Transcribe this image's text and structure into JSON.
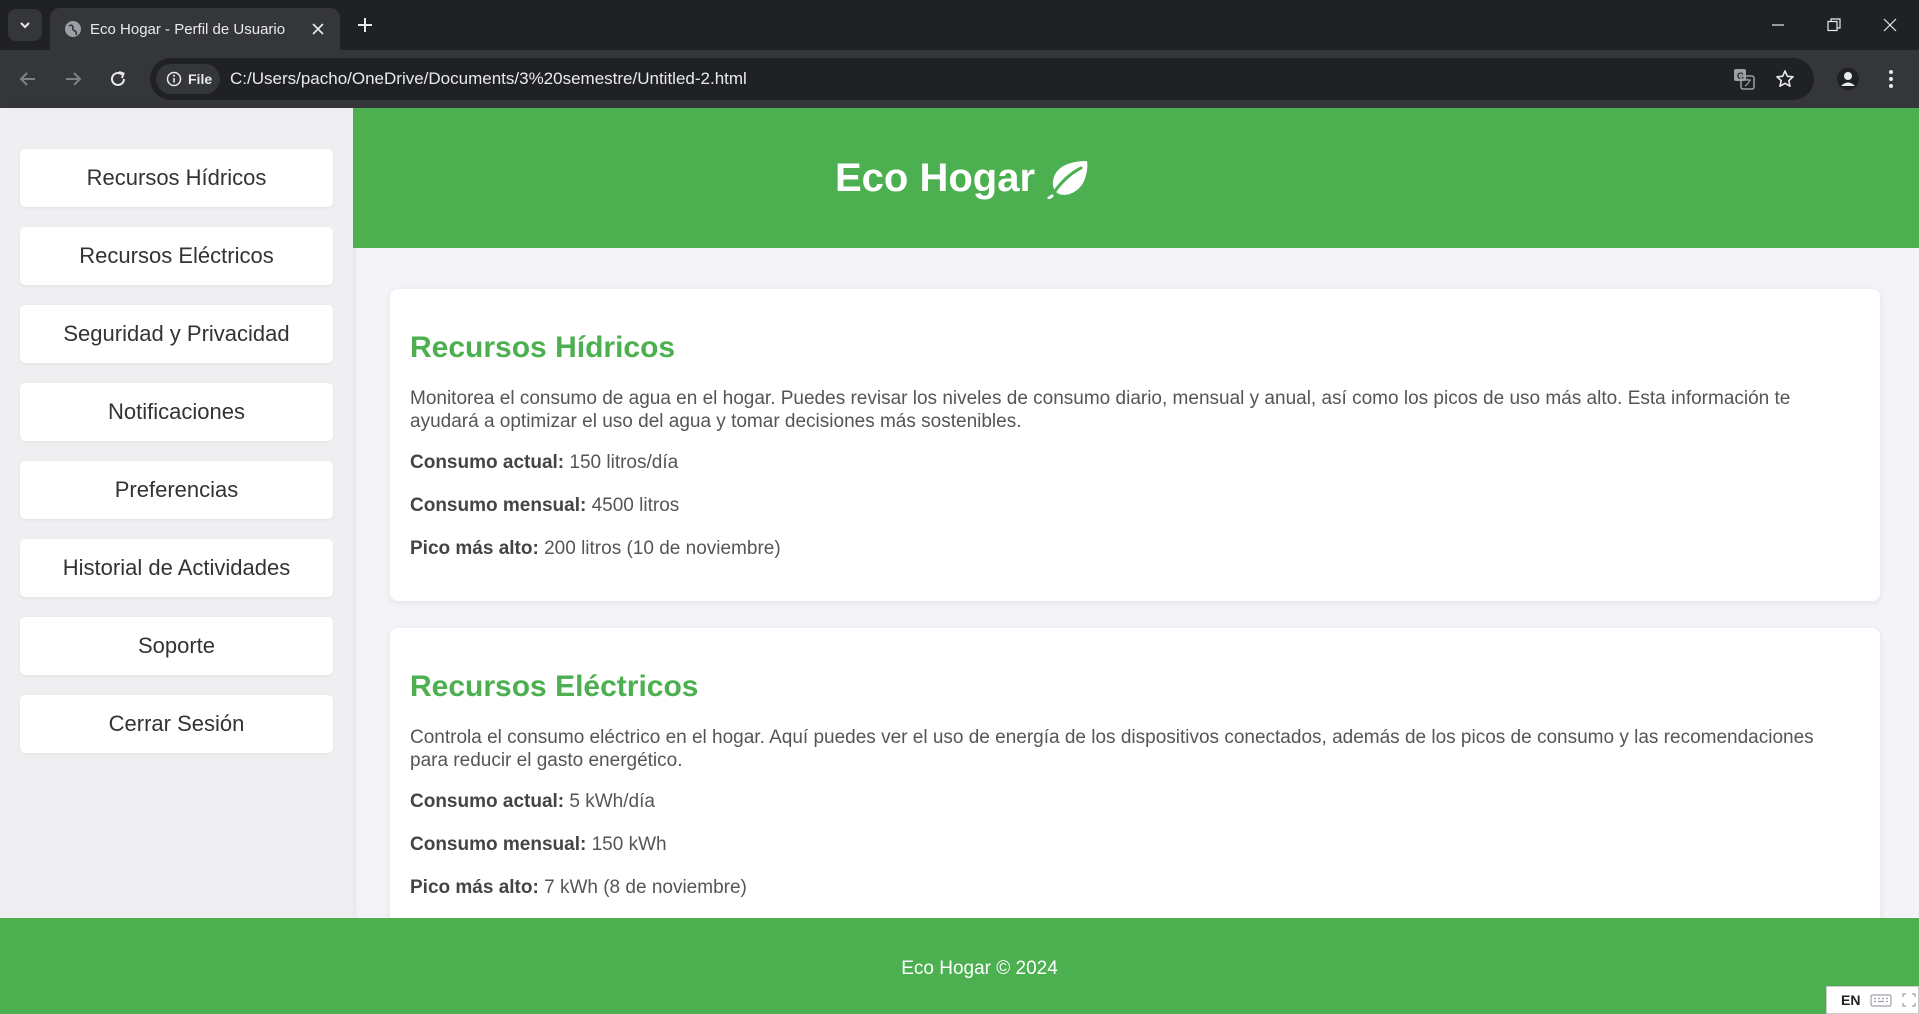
{
  "browser": {
    "tab_title": "Eco Hogar - Perfil de Usuario",
    "site_chip_label": "File",
    "url": "C:/Users/pacho/OneDrive/Documents/3%20semestre/Untitled-2.html"
  },
  "colors": {
    "accent_green": "#4caf50",
    "sidebar_bg": "#efeff1",
    "page_bg": "#f4f4f8",
    "chrome_dark": "#202124",
    "chrome_toolbar": "#35363a"
  },
  "sidebar": {
    "items": [
      {
        "label": "Recursos Hídricos"
      },
      {
        "label": "Recursos Eléctricos"
      },
      {
        "label": "Seguridad y Privacidad"
      },
      {
        "label": "Notificaciones"
      },
      {
        "label": "Preferencias"
      },
      {
        "label": "Historial de Actividades"
      },
      {
        "label": "Soporte"
      },
      {
        "label": "Cerrar Sesión"
      }
    ]
  },
  "header": {
    "title": "Eco Hogar",
    "icon": "leaf-icon"
  },
  "sections": [
    {
      "title": "Recursos Hídricos",
      "description": "Monitorea el consumo de agua en el hogar. Puedes revisar los niveles de consumo diario, mensual y anual, así como los picos de uso más alto. Esta información te ayudará a optimizar el uso del agua y tomar decisiones más sostenibles.",
      "stats": [
        {
          "label": "Consumo actual:",
          "value": "150 litros/día"
        },
        {
          "label": "Consumo mensual:",
          "value": "4500 litros"
        },
        {
          "label": "Pico más alto:",
          "value": "200 litros (10 de noviembre)"
        }
      ]
    },
    {
      "title": "Recursos Eléctricos",
      "description": "Controla el consumo eléctrico en el hogar. Aquí puedes ver el uso de energía de los dispositivos conectados, además de los picos de consumo y las recomendaciones para reducir el gasto energético.",
      "stats": [
        {
          "label": "Consumo actual:",
          "value": "5 kWh/día"
        },
        {
          "label": "Consumo mensual:",
          "value": "150 kWh"
        },
        {
          "label": "Pico más alto:",
          "value": "7 kWh (8 de noviembre)"
        }
      ]
    }
  ],
  "footer": {
    "text": "Eco Hogar © 2024"
  },
  "system_tray": {
    "language": "EN"
  }
}
